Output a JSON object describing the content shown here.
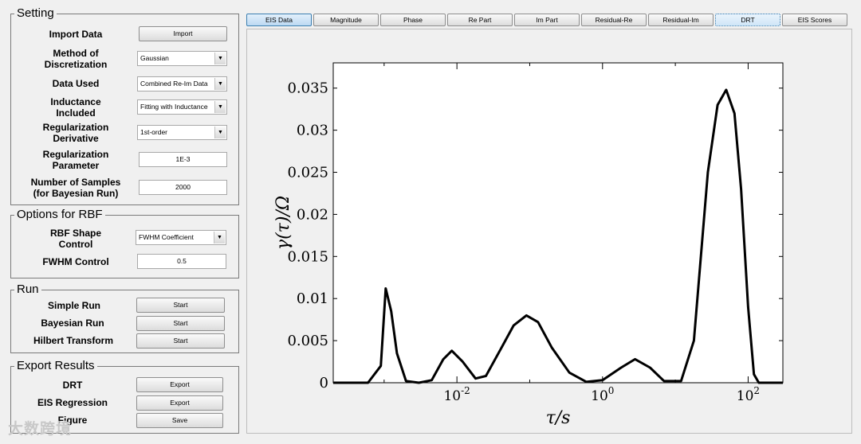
{
  "setting": {
    "title": "Setting",
    "import_label": "Import Data",
    "import_button": "Import",
    "discretization_label_1": "Method of",
    "discretization_label_2": "Discretization",
    "discretization_value": "Gaussian",
    "data_used_label": "Data Used",
    "data_used_value": "Combined Re-Im Data",
    "inductance_label_1": "Inductance",
    "inductance_label_2": "Included",
    "inductance_value": "Fitting with Inductance",
    "reg_derivative_label_1": "Regularization",
    "reg_derivative_label_2": "Derivative",
    "reg_derivative_value": "1st-order",
    "reg_param_label_1": "Regularization",
    "reg_param_label_2": "Parameter",
    "reg_param_value": "1E-3",
    "samples_label_1": "Number of Samples",
    "samples_label_2": "(for Bayesian Run)",
    "samples_value": "2000"
  },
  "rbf": {
    "title": "Options for RBF",
    "shape_label_1": "RBF Shape",
    "shape_label_2": "Control",
    "shape_value": "FWHM Coefficient",
    "fwhm_label": "FWHM Control",
    "fwhm_value": "0.5"
  },
  "run": {
    "title": "Run",
    "simple_label": "Simple Run",
    "simple_button": "Start",
    "bayesian_label": "Bayesian Run",
    "bayesian_button": "Start",
    "hilbert_label": "Hilbert Transform",
    "hilbert_button": "Start"
  },
  "export": {
    "title": "Export Results",
    "drt_label": "DRT",
    "drt_button": "Export",
    "eis_label": "EIS Regression",
    "eis_button": "Export",
    "figure_label": "Figure",
    "figure_button": "Save"
  },
  "tabs": [
    "EIS Data",
    "Magnitude",
    "Phase",
    "Re Part",
    "Im Part",
    "Residual-Re",
    "Residual-Im",
    "DRT",
    "EIS Scores"
  ],
  "watermark": "大数跨境",
  "chart_data": {
    "type": "line",
    "xlabel": "τ/s",
    "ylabel": "γ(τ)/Ω",
    "x_scale": "log",
    "xlim": [
      0.0002,
      300
    ],
    "ylim": [
      0,
      0.038
    ],
    "x_ticks": [
      "10^-2",
      "10^0",
      "10^2"
    ],
    "y_ticks": [
      "0",
      "0.005",
      "0.01",
      "0.015",
      "0.02",
      "0.025",
      "0.03",
      "0.035"
    ],
    "grid": false,
    "series": [
      {
        "color": "#000000",
        "points": [
          [
            0.0002,
            0
          ],
          [
            0.0006,
            0
          ],
          [
            0.0009,
            0.002
          ],
          [
            0.00105,
            0.0112
          ],
          [
            0.00125,
            0.0085
          ],
          [
            0.0015,
            0.0035
          ],
          [
            0.002,
            0.0002
          ],
          [
            0.003,
            0
          ],
          [
            0.0045,
            0.0003
          ],
          [
            0.0065,
            0.0028
          ],
          [
            0.0085,
            0.0038
          ],
          [
            0.012,
            0.0025
          ],
          [
            0.018,
            0.0005
          ],
          [
            0.025,
            0.0008
          ],
          [
            0.04,
            0.004
          ],
          [
            0.06,
            0.0068
          ],
          [
            0.09,
            0.008
          ],
          [
            0.13,
            0.0072
          ],
          [
            0.2,
            0.0042
          ],
          [
            0.35,
            0.0012
          ],
          [
            0.6,
            0.0001
          ],
          [
            1.0,
            0.0003
          ],
          [
            1.8,
            0.0018
          ],
          [
            2.8,
            0.0028
          ],
          [
            4.5,
            0.0018
          ],
          [
            7,
            0.0002
          ],
          [
            12,
            0.0002
          ],
          [
            18,
            0.005
          ],
          [
            28,
            0.025
          ],
          [
            38,
            0.033
          ],
          [
            50,
            0.0348
          ],
          [
            65,
            0.032
          ],
          [
            80,
            0.023
          ],
          [
            100,
            0.009
          ],
          [
            120,
            0.001
          ],
          [
            140,
            0
          ],
          [
            300,
            0
          ]
        ]
      }
    ]
  }
}
